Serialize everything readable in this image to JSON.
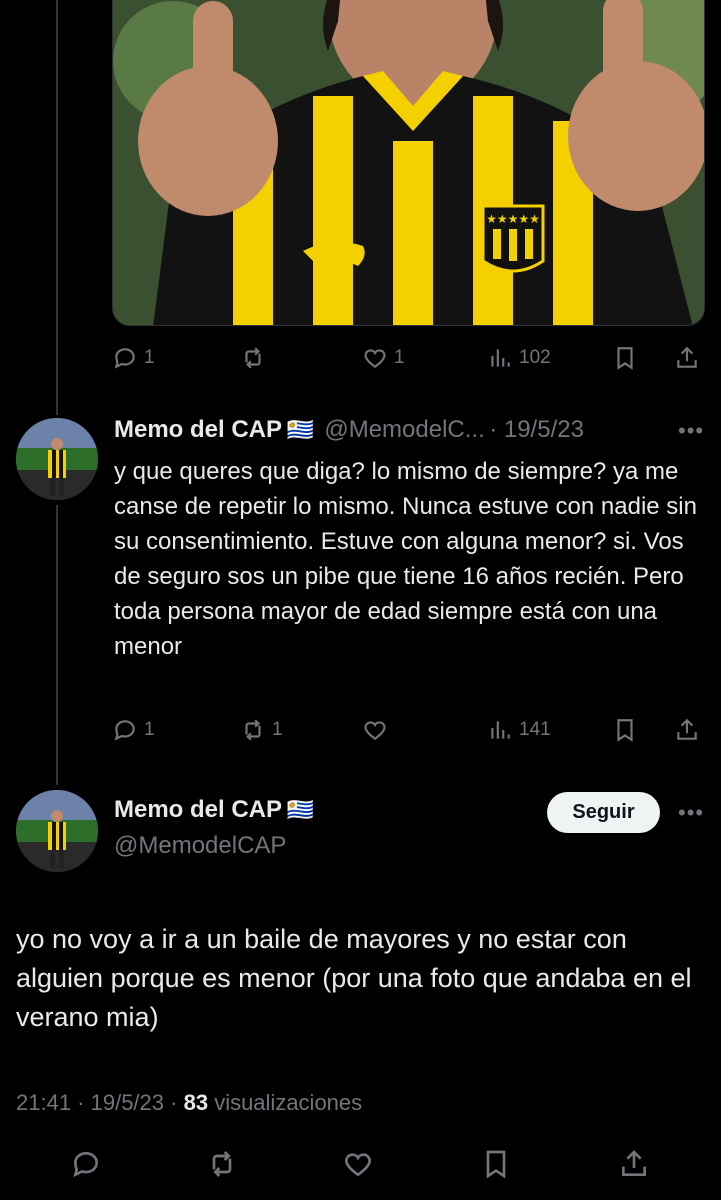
{
  "reply_tweet": {
    "actions": {
      "replies": "1",
      "retweets": "",
      "likes": "1",
      "views": "102"
    }
  },
  "quoted_tweet": {
    "author_name": "Memo del CAP",
    "flag": "🇺🇾",
    "handle": "@MemodelC...",
    "date": "· 19/5/23",
    "text": "y que queres que diga? lo mismo de siempre? ya me canse de repetir lo mismo. Nunca estuve con nadie sin su consentimiento. Estuve con alguna menor? si. Vos de seguro sos un pibe que tiene 16 años recién. Pero toda persona mayor de edad siempre está con una menor",
    "actions": {
      "replies": "1",
      "retweets": "1",
      "likes": "",
      "views": "141"
    }
  },
  "main_tweet": {
    "author_name": "Memo del CAP",
    "flag": "🇺🇾",
    "handle": "@MemodelCAP",
    "follow_label": "Seguir",
    "text": "yo no voy a ir a un baile de mayores y no estar con alguien porque es menor (por una foto que andaba en el verano mia)",
    "time": "21:41 · 19/5/23 ·",
    "views_count": "83",
    "views_label": "visualizaciones"
  },
  "colors": {
    "background": "#000000",
    "text": "#e7e9ea",
    "muted": "#71767b",
    "follow_button_bg": "#eff3f4",
    "jersey_yellow": "#f5d000"
  }
}
